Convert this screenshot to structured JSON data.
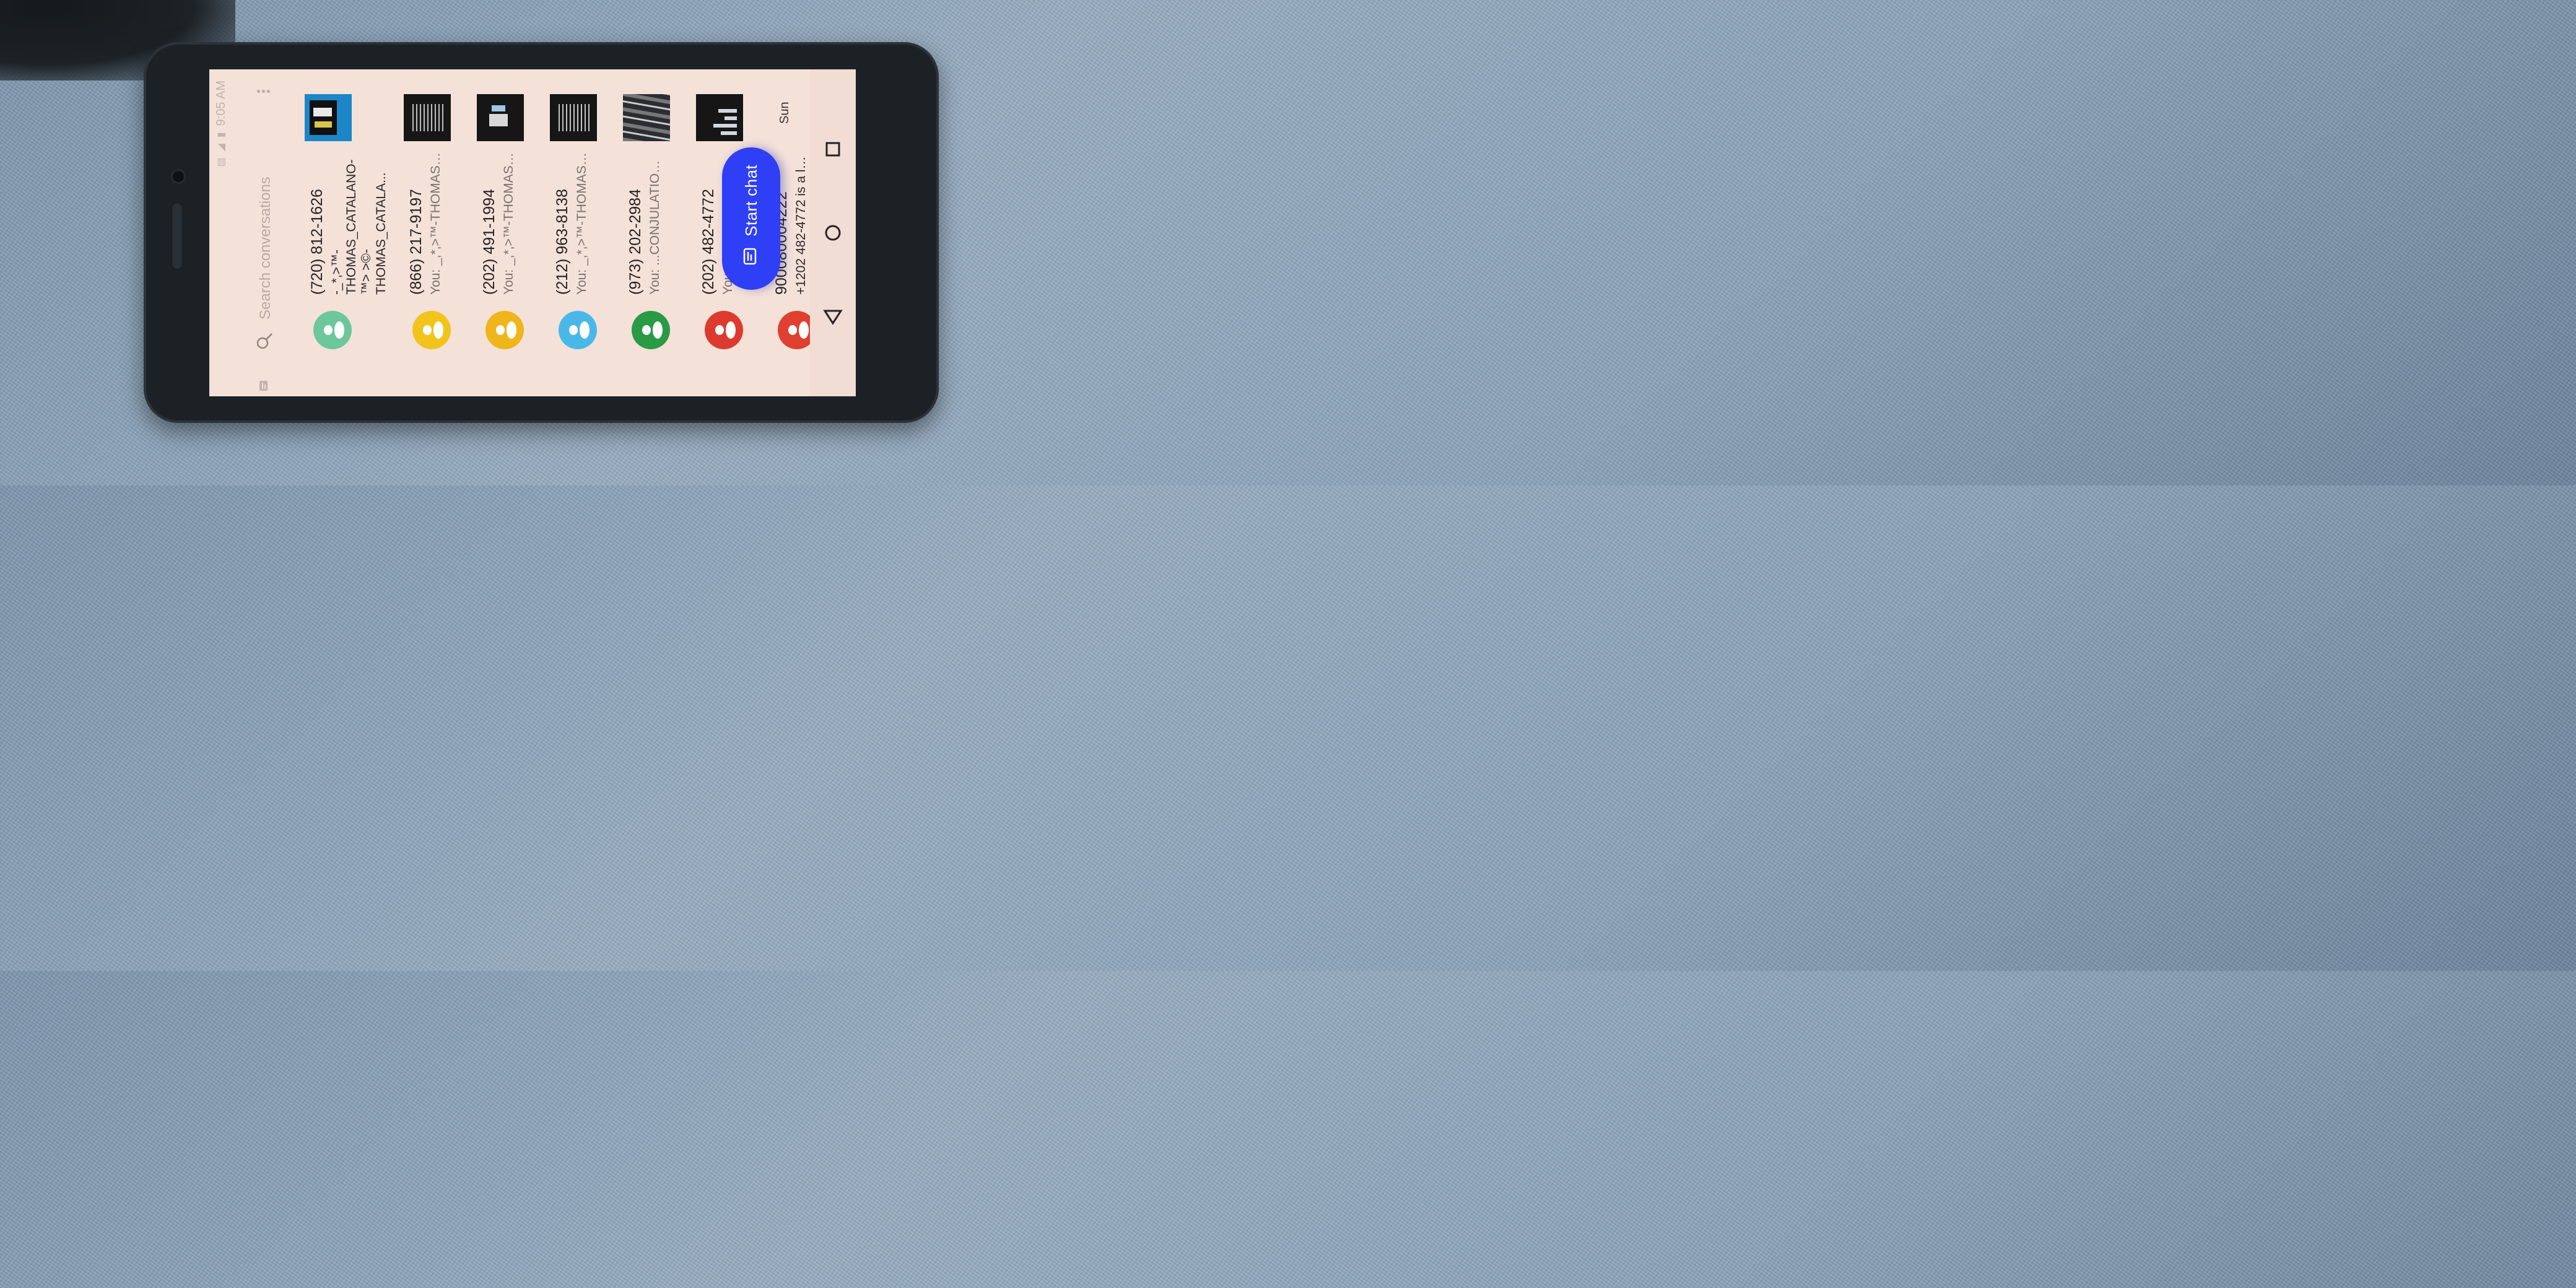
{
  "status_bar": {
    "time": "9:05 AM"
  },
  "search": {
    "placeholder": "Search conversations"
  },
  "conversations": [
    {
      "name": "(720) 812-1626",
      "snippet": "-_*,>™-THOMAS_CATALANO-™> >©-THOMAS_CATALA...",
      "avatar_color": "#6cc79a"
    },
    {
      "name": "(866) 217-9197",
      "snippet": "You: _,*,>™-THOMAS_...",
      "avatar_color": "#f2c31a"
    },
    {
      "name": "(202) 491-1994",
      "snippet": "You: _,*,>™-THOMAS_...",
      "avatar_color": "#efb61b"
    },
    {
      "name": "(212) 963-8138",
      "snippet": "You: _,*,>™-THOMAS_...",
      "avatar_color": "#49b8e8"
    },
    {
      "name": "(973) 202-2984",
      "snippet": "You: ...CONJULATION ...",
      "avatar_color": "#2a9a44"
    },
    {
      "name": "(202) 482-4772",
      "snippet": "You: >™-THOMA",
      "avatar_color": "#dd3a2f"
    },
    {
      "name": "900080004222",
      "snippet": "+1202 482-4772 is a landli",
      "time": "Sun",
      "avatar_color": "#e0402f"
    }
  ],
  "fab": {
    "label": "Start chat"
  },
  "colors": {
    "accent": "#2f3ff5"
  },
  "icons": [
    "message-icon",
    "search-icon",
    "more-vert-icon",
    "person-icon",
    "chat-icon",
    "back-icon",
    "home-icon",
    "recents-icon"
  ]
}
